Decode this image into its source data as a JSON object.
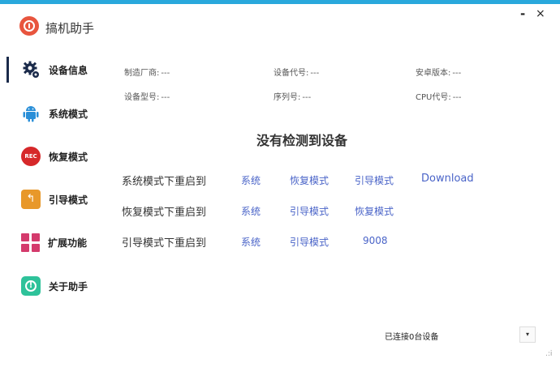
{
  "window": {
    "minimize_glyph": "-",
    "close_glyph": "×"
  },
  "app": {
    "title": "搞机助手",
    "logo_icon": "app-logo-icon"
  },
  "sidebar": {
    "items": [
      {
        "label": "设备信息",
        "icon": "gear-icon",
        "active": true
      },
      {
        "label": "系统模式",
        "icon": "android-icon"
      },
      {
        "label": "恢复模式",
        "icon": "rec-icon",
        "icon_text": "REC"
      },
      {
        "label": "引导模式",
        "icon": "back-arrow-icon",
        "icon_text": "↰"
      },
      {
        "label": "扩展功能",
        "icon": "grid-icon"
      },
      {
        "label": "关于助手",
        "icon": "info-icon"
      }
    ]
  },
  "device_info": {
    "manufacturer": {
      "label": "制造厂商:",
      "value": "---"
    },
    "device_code": {
      "label": "设备代号:",
      "value": "---"
    },
    "android_version": {
      "label": "安卓版本:",
      "value": "---"
    },
    "model": {
      "label": "设备型号:",
      "value": "---"
    },
    "serial": {
      "label": "序列号:",
      "value": "---"
    },
    "cpu_code": {
      "label": "CPU代号:",
      "value": "---"
    }
  },
  "status_message": "没有检测到设备",
  "reboot": {
    "system_row": {
      "label": "系统模式下重启到",
      "options": [
        "系统",
        "恢复模式",
        "引导模式",
        "Download"
      ]
    },
    "recovery_row": {
      "label": "恢复模式下重启到",
      "options": [
        "系统",
        "引导模式",
        "恢复模式"
      ]
    },
    "bootloader_row": {
      "label": "引导模式下重启到",
      "options": [
        "系统",
        "引导模式",
        "9008"
      ]
    }
  },
  "footer": {
    "connection_status": "已连接0台设备",
    "dropdown_glyph": "▾",
    "grip_glyph": ".:i"
  },
  "colors": {
    "accent": "#29a8dc",
    "link": "#4a64c8",
    "nav_indicator": "#1a2a4a"
  }
}
